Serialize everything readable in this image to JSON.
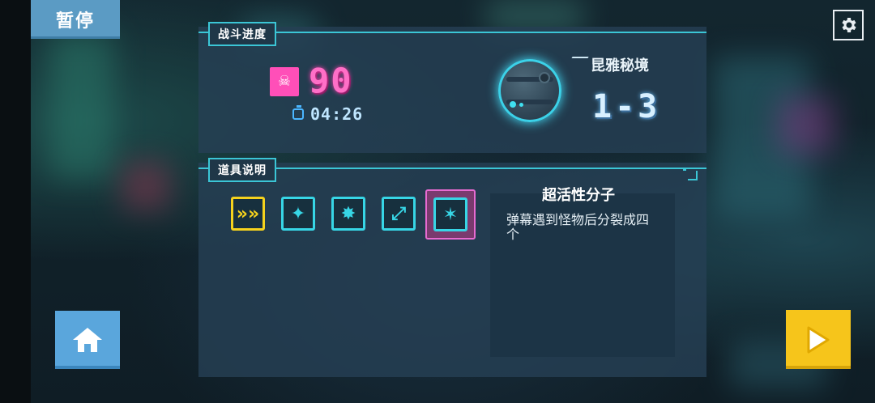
{
  "header": {
    "pause_label": "暂停",
    "settings_icon": "gear-icon"
  },
  "battle_progress": {
    "label": "战斗进度",
    "kill_count": "90",
    "timer": "04:26",
    "stage_name": "昆雅秘境",
    "stage_number": "1-3"
  },
  "item_info": {
    "label": "道具说明",
    "items": [
      {
        "icon": "chevrons-icon",
        "glyph": "»»",
        "color": "#f5d21d"
      },
      {
        "icon": "shuriken-icon",
        "glyph": "✦",
        "color": "#37d6e6"
      },
      {
        "icon": "explosion-icon",
        "glyph": "✸",
        "color": "#37d6e6"
      },
      {
        "icon": "arrow-diagonal-icon",
        "glyph": "⤢",
        "color": "#37d6e6"
      },
      {
        "icon": "split-molecule-icon",
        "glyph": "✶",
        "color": "#37d6e6",
        "selected": true
      }
    ],
    "selected_title": "超活性分子",
    "selected_description": "弹幕遇到怪物后分裂成四个"
  },
  "buttons": {
    "home_icon": "home-icon",
    "play_icon": "play-icon"
  },
  "colors": {
    "accent": "#3bc6d6",
    "kill_pink": "#ff6fc7",
    "play_yellow": "#f6c51b",
    "home_blue": "#5aa6dc"
  }
}
